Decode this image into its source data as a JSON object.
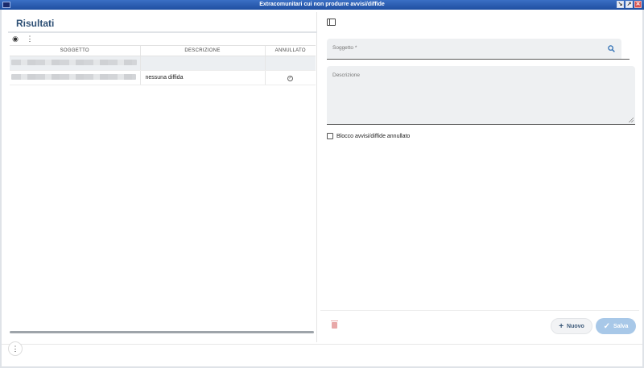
{
  "window": {
    "title": "Extracomunitari cui non produrre avvisi/diffide",
    "buttons": {
      "minimize": "↘",
      "maximize": "↗",
      "close": "✕"
    }
  },
  "left_panel": {
    "title": "Risultati",
    "toolbar": {
      "view_icon": "eye-icon",
      "menu_icon": "more-vert-icon",
      "view_glyph": "◉",
      "menu_glyph": "⋮"
    },
    "table": {
      "columns": [
        "SOGGETTO",
        "DESCRIZIONE",
        "ANNULLATO"
      ],
      "rows": [
        {
          "soggetto": "",
          "descrizione": "",
          "annullato": "",
          "selected": true
        },
        {
          "soggetto": "",
          "descrizione": "nessuna diffida",
          "annullato": "✓",
          "selected": false
        }
      ]
    }
  },
  "form": {
    "soggetto_label": "Soggetto *",
    "descrizione_label": "Descrizione",
    "checkbox_label": "Blocco avvisi/diffide annullato",
    "search_glyph": "🔍"
  },
  "actions": {
    "nuovo_label": "Nuovo",
    "nuovo_glyph": "+",
    "salva_label": "Salva",
    "salva_glyph": "✓"
  },
  "bottom": {
    "more_glyph": "⋮"
  },
  "colors": {
    "accent": "#2f6fb4",
    "title": "#2d4f74",
    "salva_disabled": "#a8c8e8",
    "delete_disabled": "#e8a8a8"
  }
}
